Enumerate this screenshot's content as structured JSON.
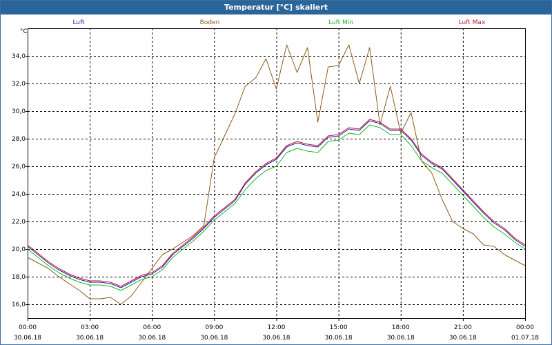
{
  "window": {
    "title": "Temperatur [°C] skaliert"
  },
  "chart_data": {
    "type": "line",
    "title": "Temperatur [°C] skaliert",
    "ylabel": "°C",
    "xlabel": "",
    "ylim": [
      15,
      36
    ],
    "xlim": [
      0,
      24
    ],
    "grid": true,
    "legend": "top",
    "yticks": [
      16,
      18,
      20,
      22,
      24,
      26,
      28,
      30,
      32,
      34
    ],
    "ytick_labels": [
      "16,0",
      "18,0",
      "20,0",
      "22,0",
      "24,0",
      "26,0",
      "28,0",
      "30,0",
      "32,0",
      "34,0"
    ],
    "xticks": [
      0,
      3,
      6,
      9,
      12,
      15,
      18,
      21,
      24
    ],
    "xtick_labels": [
      [
        "00:00",
        "30.06.18"
      ],
      [
        "03:00",
        "30.06.18"
      ],
      [
        "06:00",
        "30.06.18"
      ],
      [
        "09:00",
        "30.06.18"
      ],
      [
        "12:00",
        "30.06.18"
      ],
      [
        "15:00",
        "30.06.18"
      ],
      [
        "18:00",
        "30.06.18"
      ],
      [
        "21:00",
        "30.06.18"
      ],
      [
        "00:00",
        "01.07.18"
      ]
    ],
    "series": [
      {
        "name": "Luft",
        "color": "#1a1aa8",
        "x": [
          0,
          0.5,
          1,
          1.5,
          2,
          2.5,
          3,
          3.5,
          4,
          4.5,
          5,
          5.5,
          6,
          6.5,
          7,
          7.5,
          8,
          8.5,
          9,
          9.5,
          10,
          10.5,
          11,
          11.5,
          12,
          12.5,
          13,
          13.5,
          14,
          14.5,
          15,
          15.5,
          16,
          16.5,
          17,
          17.5,
          18,
          18.5,
          19,
          19.5,
          20,
          20.5,
          21,
          21.5,
          22,
          22.5,
          23,
          23.5,
          24
        ],
        "y": [
          20.2,
          19.6,
          19.0,
          18.5,
          18.1,
          17.8,
          17.6,
          17.6,
          17.5,
          17.2,
          17.6,
          18.0,
          18.2,
          18.7,
          19.6,
          20.2,
          20.8,
          21.5,
          22.3,
          22.9,
          23.5,
          24.7,
          25.5,
          26.1,
          26.5,
          27.4,
          27.7,
          27.5,
          27.4,
          28.1,
          28.2,
          28.7,
          28.6,
          29.3,
          29.1,
          28.6,
          28.6,
          27.9,
          26.8,
          26.2,
          25.8,
          25.0,
          24.2,
          23.4,
          22.6,
          21.9,
          21.4,
          20.7,
          20.2
        ]
      },
      {
        "name": "Boden",
        "color": "#8b5a1a",
        "x": [
          0,
          0.5,
          1,
          1.5,
          2,
          2.5,
          3,
          3.5,
          4,
          4.5,
          5,
          5.5,
          6,
          6.5,
          7,
          7.5,
          8,
          8.5,
          9,
          9.5,
          10,
          10.5,
          11,
          11.5,
          12,
          12.5,
          13,
          13.5,
          14,
          14.5,
          15,
          15.5,
          16,
          16.5,
          17,
          17.5,
          18,
          18.5,
          19,
          19.5,
          20,
          20.5,
          21,
          21.5,
          22,
          22.5,
          23,
          23.5,
          24
        ],
        "y": [
          19.4,
          19.0,
          18.6,
          18.0,
          17.5,
          17.0,
          16.4,
          16.4,
          16.5,
          16.0,
          16.6,
          17.6,
          18.6,
          19.6,
          20.0,
          20.5,
          21.0,
          21.7,
          26.6,
          28.2,
          29.8,
          31.8,
          32.4,
          33.8,
          31.6,
          34.8,
          32.8,
          34.6,
          29.2,
          33.2,
          33.3,
          34.8,
          32.0,
          34.6,
          29.0,
          31.8,
          28.4,
          29.9,
          26.4,
          25.5,
          23.6,
          22.0,
          21.5,
          21.1,
          20.3,
          20.2,
          19.6,
          19.2,
          18.8
        ]
      },
      {
        "name": "Luft Min",
        "color": "#19b51e",
        "x": [
          0,
          0.5,
          1,
          1.5,
          2,
          2.5,
          3,
          3.5,
          4,
          4.5,
          5,
          5.5,
          6,
          6.5,
          7,
          7.5,
          8,
          8.5,
          9,
          9.5,
          10,
          10.5,
          11,
          11.5,
          12,
          12.5,
          13,
          13.5,
          14,
          14.5,
          15,
          15.5,
          16,
          16.5,
          17,
          17.5,
          18,
          18.5,
          19,
          19.5,
          20,
          20.5,
          21,
          21.5,
          22,
          22.5,
          23,
          23.5,
          24
        ],
        "y": [
          20.0,
          19.4,
          18.8,
          18.3,
          17.9,
          17.6,
          17.4,
          17.4,
          17.3,
          17.0,
          17.4,
          17.8,
          18.0,
          18.5,
          19.4,
          20.0,
          20.6,
          21.3,
          22.1,
          22.7,
          23.3,
          24.3,
          25.1,
          25.7,
          26.0,
          27.0,
          27.3,
          27.1,
          27.0,
          27.8,
          27.9,
          28.4,
          28.3,
          29.0,
          28.8,
          28.3,
          28.3,
          27.5,
          26.4,
          25.9,
          25.5,
          24.7,
          23.9,
          23.1,
          22.3,
          21.6,
          21.1,
          20.5,
          20.0
        ]
      },
      {
        "name": "Luft Max",
        "color": "#c8102e",
        "x": [
          0,
          0.5,
          1,
          1.5,
          2,
          2.5,
          3,
          3.5,
          4,
          4.5,
          5,
          5.5,
          6,
          6.5,
          7,
          7.5,
          8,
          8.5,
          9,
          9.5,
          10,
          10.5,
          11,
          11.5,
          12,
          12.5,
          13,
          13.5,
          14,
          14.5,
          15,
          15.5,
          16,
          16.5,
          17,
          17.5,
          18,
          18.5,
          19,
          19.5,
          20,
          20.5,
          21,
          21.5,
          22,
          22.5,
          23,
          23.5,
          24
        ],
        "y": [
          20.3,
          19.7,
          19.1,
          18.6,
          18.2,
          17.9,
          17.7,
          17.7,
          17.6,
          17.3,
          17.7,
          18.1,
          18.3,
          18.8,
          19.7,
          20.3,
          20.9,
          21.6,
          22.4,
          23.0,
          23.6,
          24.8,
          25.6,
          26.2,
          26.6,
          27.5,
          27.8,
          27.6,
          27.5,
          28.2,
          28.3,
          28.8,
          28.7,
          29.4,
          29.2,
          28.7,
          28.7,
          28.0,
          26.9,
          26.3,
          25.9,
          25.1,
          24.3,
          23.5,
          22.7,
          22.0,
          21.5,
          20.8,
          20.3
        ]
      }
    ]
  }
}
